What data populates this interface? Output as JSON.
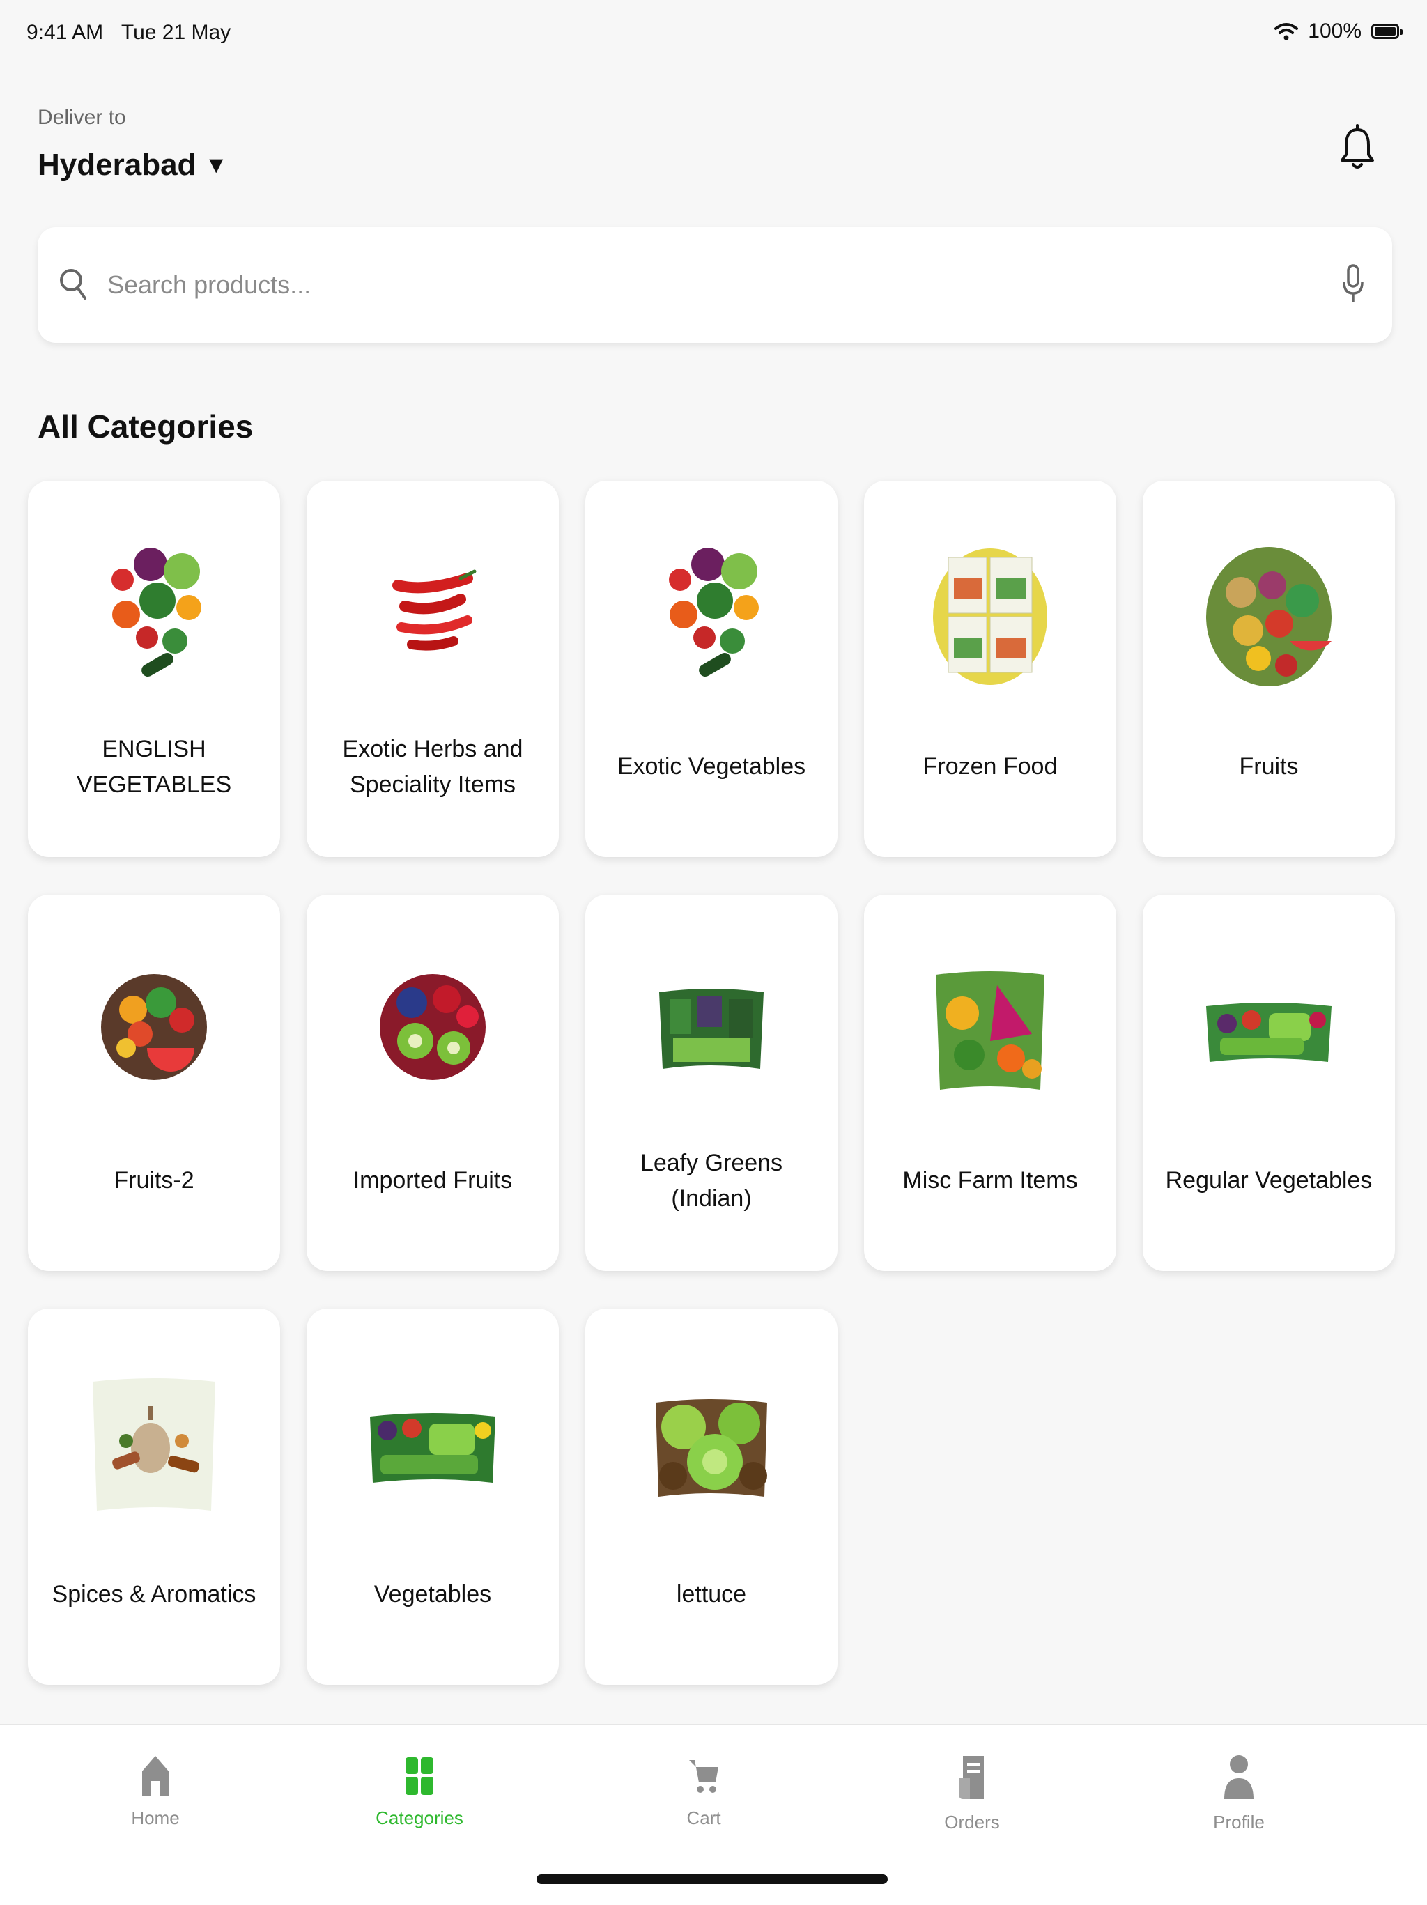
{
  "status_bar": {
    "time": "9:41 AM",
    "date": "Tue 21 May",
    "battery": "100%"
  },
  "header": {
    "deliver_label": "Deliver to",
    "location": "Hyderabad"
  },
  "search": {
    "placeholder": "Search products..."
  },
  "section_title": "All Categories",
  "categories": [
    {
      "label": "ENGLISH VEGETABLES"
    },
    {
      "label": "Exotic Herbs and Speciality Items"
    },
    {
      "label": "Exotic Vegetables"
    },
    {
      "label": "Frozen Food"
    },
    {
      "label": "Fruits"
    },
    {
      "label": "Fruits-2"
    },
    {
      "label": "Imported Fruits"
    },
    {
      "label": "Leafy Greens (Indian)"
    },
    {
      "label": "Misc Farm Items"
    },
    {
      "label": "Regular Vegetables"
    },
    {
      "label": "Spices & Aromatics"
    },
    {
      "label": "Vegetables"
    },
    {
      "label": "lettuce"
    }
  ],
  "tabs": [
    {
      "label": "Home",
      "icon": "home-icon",
      "active": false
    },
    {
      "label": "Categories",
      "icon": "grid-icon",
      "active": true
    },
    {
      "label": "Cart",
      "icon": "cart-icon",
      "active": false
    },
    {
      "label": "Orders",
      "icon": "orders-icon",
      "active": false
    },
    {
      "label": "Profile",
      "icon": "profile-icon",
      "active": false
    }
  ],
  "colors": {
    "accent": "#2eb82e",
    "inactive": "#8e8e8e",
    "background": "#f7f7f7"
  }
}
